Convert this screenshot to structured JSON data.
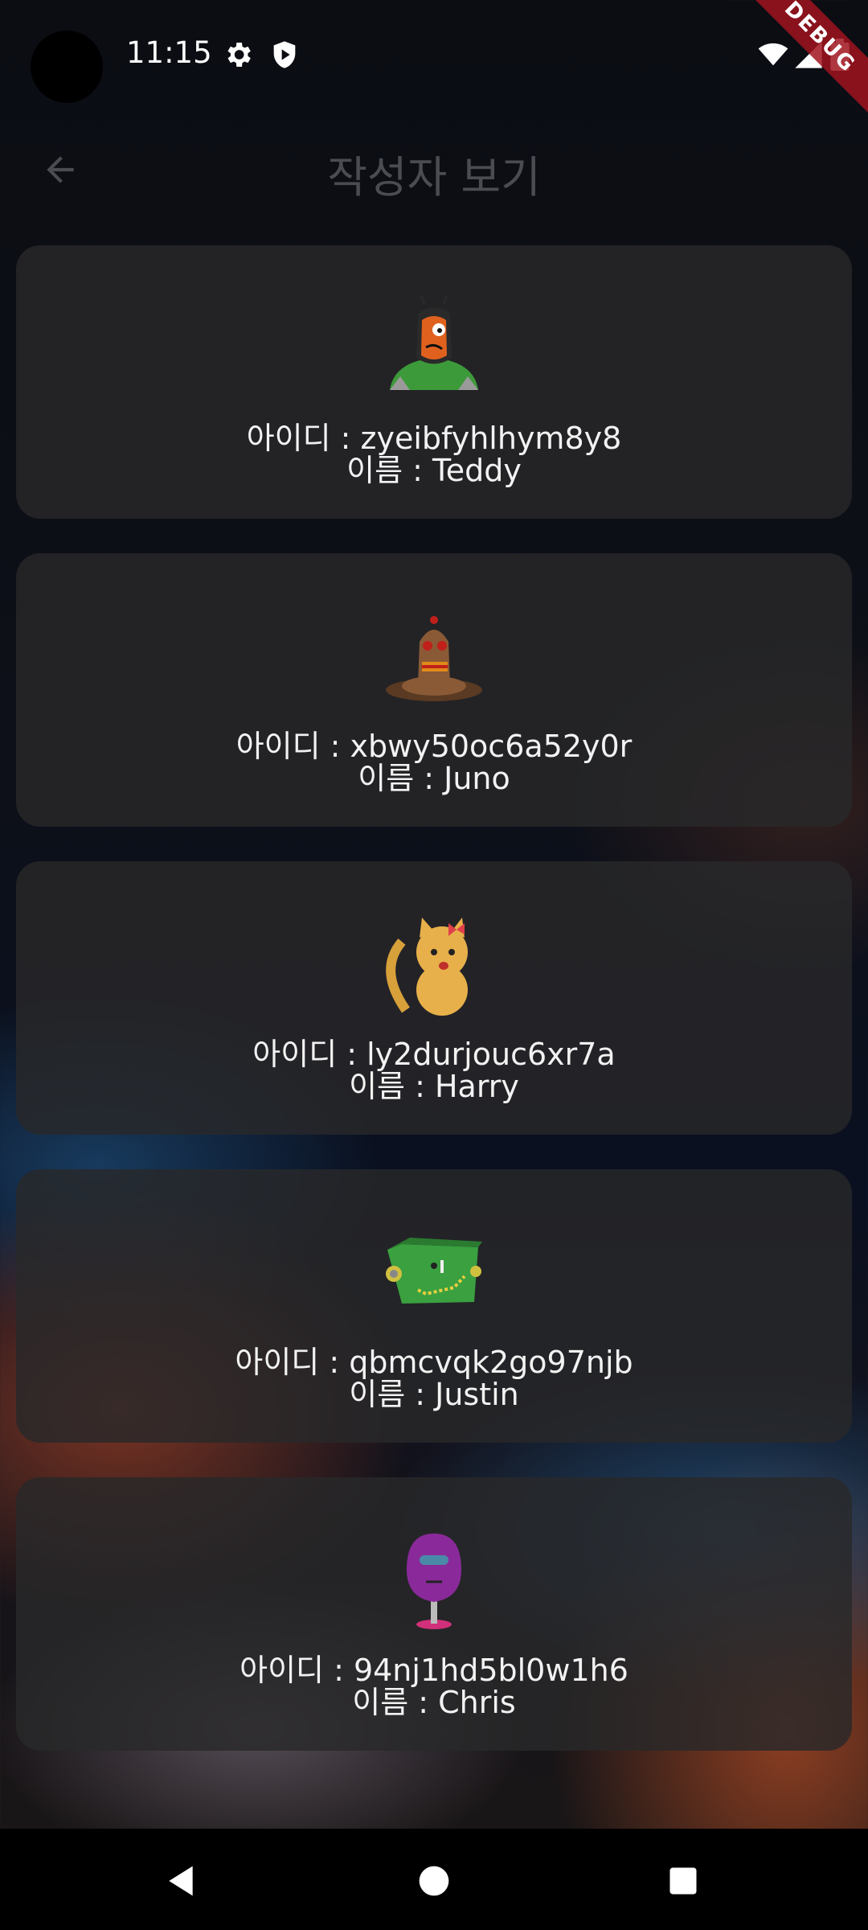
{
  "status_bar": {
    "time": "11:15",
    "icons": [
      "gear-icon",
      "shield-play-icon",
      "wifi-icon",
      "signal-icon",
      "battery-icon"
    ],
    "debug_label": "DEBUG"
  },
  "app_bar": {
    "title": "작성자 보기",
    "back_icon": "arrow-back-icon"
  },
  "users": [
    {
      "id_line": "아이디 : zyeibfyhlhym8y8",
      "name_line": "이름 : Teddy",
      "avatar": "orange-creature-avatar"
    },
    {
      "id_line": "아이디 : xbwy50oc6a52y0r",
      "name_line": "이름 : Juno",
      "avatar": "brown-snake-avatar"
    },
    {
      "id_line": "아이디 : ly2durjouc6xr7a",
      "name_line": "이름 : Harry",
      "avatar": "yellow-cat-avatar"
    },
    {
      "id_line": "아이디 : qbmcvqk2go97njb",
      "name_line": "이름 : Justin",
      "avatar": "green-robot-avatar"
    },
    {
      "id_line": "아이디 : 94nj1hd5bl0w1h6",
      "name_line": "이름 : Chris",
      "avatar": "purple-mushroom-avatar"
    }
  ],
  "nav_bar": {
    "back": "nav-back-icon",
    "home": "nav-home-icon",
    "recents": "nav-recents-icon"
  },
  "colors": {
    "card_bg": "#28282a",
    "title": "#4a4c52",
    "text": "#f2f2f2"
  }
}
